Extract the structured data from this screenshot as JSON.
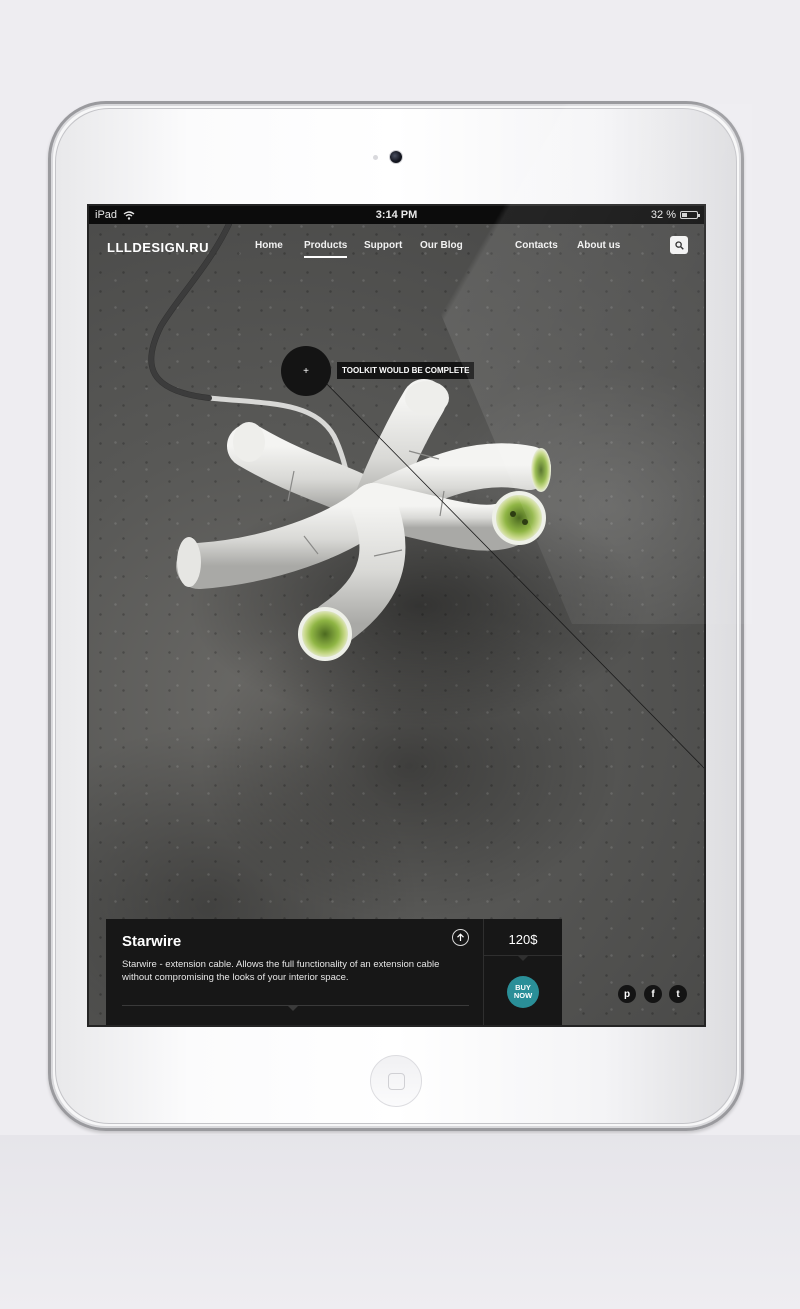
{
  "device": {
    "model": "iPad"
  },
  "status_bar": {
    "carrier": "iPad",
    "time": "3:14 PM",
    "battery": "32 %"
  },
  "site": {
    "logo": "LLLDESIGN.RU",
    "nav": [
      {
        "label": "Home"
      },
      {
        "label": "Products",
        "active": true
      },
      {
        "label": "Support"
      },
      {
        "label": "Our Blog"
      },
      {
        "label": "Contacts"
      },
      {
        "label": "About us"
      }
    ],
    "search_icon": "search-icon"
  },
  "hotspot": {
    "symbol": "+",
    "tooltip": "TOOLKIT WOULD BE COMPLETE"
  },
  "product": {
    "title": "Starwire",
    "description": "Starwire - extension cable. Allows the full functionality of an extension cable without compromising the looks of your interior space.",
    "price": "120$",
    "buy_label_line1": "BUY",
    "buy_label_line2": "NOW"
  },
  "social": [
    {
      "icon": "pinterest-icon",
      "glyph": "p"
    },
    {
      "icon": "facebook-icon",
      "glyph": "f"
    },
    {
      "icon": "twitter-icon",
      "glyph": "t"
    }
  ],
  "colors": {
    "accent": "#2a8f98",
    "panel": "#171717",
    "status_bar": "#0c0c0c"
  }
}
